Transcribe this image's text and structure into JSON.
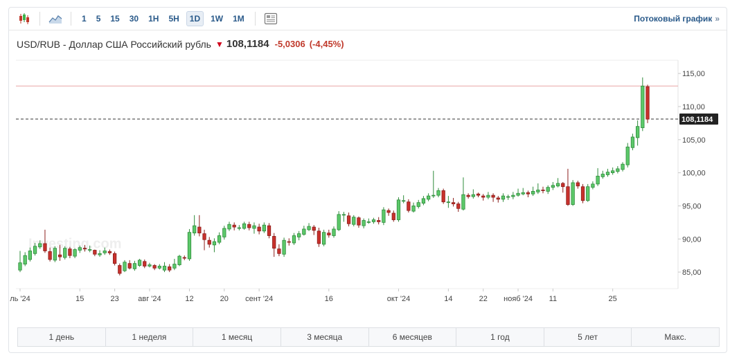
{
  "toolbar": {
    "timeframes": [
      "1",
      "5",
      "15",
      "30",
      "1H",
      "5H",
      "1D",
      "1W",
      "1M"
    ],
    "active_timeframe": "1D",
    "stream_label": "Потоковый график",
    "stream_chevron": "»"
  },
  "quote": {
    "title": "USD/RUB - Доллар США Российский рубль",
    "arrow": "🡇",
    "price": "108,1184",
    "change": "-5,0306",
    "change_pct": "(-4,45%)"
  },
  "ranges": [
    "1 день",
    "1 неделя",
    "1 месяц",
    "3 месяца",
    "6 месяцев",
    "1 год",
    "5 лет",
    "Макс."
  ],
  "colors": {
    "up": "#3cb44b",
    "down": "#c0392b",
    "up_fill": "#5cc86a",
    "down_fill": "#c8312c",
    "grid": "#ededed",
    "hline": "#e8a6a6"
  },
  "chart_data": {
    "type": "candlestick",
    "title": "",
    "ylim": [
      82.5,
      117
    ],
    "y_ticks": [
      "115,00",
      "110,00",
      "105,00",
      "100,00",
      "95,00",
      "90,00",
      "85,00"
    ],
    "y_tick_values": [
      115,
      110,
      105,
      100,
      95,
      90,
      85
    ],
    "x_ticks": [
      "ль '24",
      "15",
      "23",
      "авг '24",
      "12",
      "20",
      "сент '24",
      "16",
      "окт '24",
      "14",
      "22",
      "нояб '24",
      "11",
      "25"
    ],
    "x_tick_index": [
      0,
      12,
      19,
      26,
      34,
      41,
      48,
      62,
      76,
      86,
      93,
      100,
      107,
      119
    ],
    "last_price": 108.1184,
    "last_label": "108,1184",
    "hline": 113.1,
    "candles": [
      [
        85.3,
        86.4,
        88.2,
        85.0
      ],
      [
        86.2,
        87.5,
        88.0,
        85.9
      ],
      [
        86.9,
        88.2,
        88.7,
        86.6
      ],
      [
        87.8,
        88.9,
        89.4,
        87.5
      ],
      [
        88.8,
        89.3,
        89.8,
        88.5
      ],
      [
        89.3,
        88.2,
        91.4,
        87.9
      ],
      [
        88.1,
        86.9,
        88.7,
        86.6
      ],
      [
        86.8,
        88.6,
        88.9,
        86.5
      ],
      [
        87.6,
        87.3,
        89.1,
        86.7
      ],
      [
        87.2,
        88.6,
        88.9,
        86.9
      ],
      [
        88.5,
        87.5,
        88.8,
        87.1
      ],
      [
        87.4,
        88.4,
        88.6,
        87.1
      ],
      [
        88.3,
        88.7,
        89.0,
        87.9
      ],
      [
        88.6,
        88.5,
        89.1,
        88.1
      ],
      [
        88.4,
        88.4,
        89.0,
        88.0
      ],
      [
        88.3,
        87.7,
        88.4,
        87.4
      ],
      [
        87.6,
        87.8,
        88.3,
        87.3
      ],
      [
        87.9,
        88.2,
        88.7,
        87.6
      ],
      [
        88.1,
        87.9,
        88.4,
        87.6
      ],
      [
        87.8,
        86.3,
        88.1,
        86.0
      ],
      [
        86.0,
        84.8,
        86.3,
        84.5
      ],
      [
        85.2,
        86.5,
        86.8,
        85.0
      ],
      [
        86.3,
        85.6,
        86.8,
        85.4
      ],
      [
        85.5,
        86.3,
        86.7,
        85.2
      ],
      [
        86.0,
        86.8,
        87.0,
        85.8
      ],
      [
        86.6,
        85.9,
        86.9,
        85.6
      ],
      [
        85.9,
        86.1,
        86.4,
        85.7
      ],
      [
        86.0,
        85.6,
        86.2,
        85.3
      ],
      [
        85.6,
        85.9,
        86.2,
        85.4
      ],
      [
        85.3,
        85.9,
        86.5,
        85.0
      ],
      [
        85.8,
        85.3,
        86.2,
        85.0
      ],
      [
        85.6,
        86.2,
        87.0,
        85.3
      ],
      [
        86.1,
        87.4,
        87.6,
        85.9
      ],
      [
        87.2,
        87.1,
        87.5,
        86.8
      ],
      [
        87.0,
        91.0,
        91.5,
        86.7
      ],
      [
        90.9,
        92.0,
        93.6,
        90.5
      ],
      [
        91.8,
        90.9,
        93.6,
        90.4
      ],
      [
        90.8,
        89.9,
        91.4,
        88.3
      ],
      [
        89.8,
        89.2,
        90.3,
        88.7
      ],
      [
        89.1,
        89.6,
        90.1,
        88.0
      ],
      [
        89.5,
        90.5,
        91.0,
        89.2
      ],
      [
        90.3,
        91.6,
        92.0,
        89.9
      ],
      [
        91.5,
        92.2,
        92.6,
        91.2
      ],
      [
        92.1,
        91.8,
        92.5,
        91.3
      ],
      [
        91.7,
        91.7,
        92.1,
        91.3
      ],
      [
        91.6,
        92.3,
        92.6,
        91.4
      ],
      [
        92.2,
        91.7,
        92.6,
        91.3
      ],
      [
        91.6,
        92.0,
        92.5,
        90.8
      ],
      [
        91.8,
        91.2,
        92.3,
        90.7
      ],
      [
        91.2,
        92.1,
        92.5,
        90.9
      ],
      [
        92.0,
        90.5,
        92.4,
        90.1
      ],
      [
        90.4,
        88.6,
        90.9,
        87.3
      ],
      [
        88.5,
        87.8,
        89.2,
        87.4
      ],
      [
        87.7,
        89.8,
        90.2,
        87.3
      ],
      [
        89.6,
        89.5,
        90.1,
        89.0
      ],
      [
        89.4,
        90.5,
        90.9,
        89.1
      ],
      [
        90.3,
        90.8,
        91.2,
        89.8
      ],
      [
        90.7,
        91.5,
        92.0,
        90.5
      ],
      [
        91.4,
        91.9,
        92.4,
        91.2
      ],
      [
        91.8,
        91.3,
        92.1,
        90.6
      ],
      [
        91.2,
        89.3,
        91.7,
        88.8
      ],
      [
        89.2,
        91.0,
        91.4,
        88.9
      ],
      [
        90.9,
        90.6,
        91.4,
        90.2
      ],
      [
        90.5,
        91.5,
        91.9,
        90.2
      ],
      [
        91.4,
        93.7,
        94.2,
        91.2
      ],
      [
        93.6,
        93.7,
        94.1,
        92.6
      ],
      [
        93.5,
        92.3,
        94.0,
        91.9
      ],
      [
        92.2,
        93.3,
        93.6,
        91.9
      ],
      [
        93.2,
        92.1,
        93.4,
        91.7
      ],
      [
        92.0,
        92.8,
        93.1,
        91.6
      ],
      [
        92.6,
        92.6,
        93.1,
        92.3
      ],
      [
        92.6,
        92.9,
        93.2,
        92.3
      ],
      [
        92.8,
        92.6,
        93.3,
        92.2
      ],
      [
        92.5,
        94.4,
        94.8,
        92.1
      ],
      [
        94.3,
        94.0,
        94.6,
        93.5
      ],
      [
        93.9,
        92.9,
        94.3,
        92.6
      ],
      [
        92.9,
        95.9,
        96.3,
        92.6
      ],
      [
        95.8,
        95.8,
        96.6,
        95.4
      ],
      [
        95.6,
        94.3,
        96.0,
        94.0
      ],
      [
        94.2,
        95.0,
        95.5,
        94.0
      ],
      [
        94.9,
        95.5,
        95.9,
        94.6
      ],
      [
        95.4,
        96.1,
        96.5,
        95.1
      ],
      [
        96.0,
        96.5,
        96.9,
        95.7
      ],
      [
        96.5,
        96.6,
        100.3,
        96.2
      ],
      [
        96.6,
        97.3,
        97.7,
        96.3
      ],
      [
        97.3,
        95.6,
        97.6,
        95.3
      ],
      [
        95.6,
        95.6,
        96.5,
        94.7
      ],
      [
        95.5,
        95.3,
        96.2,
        94.9
      ],
      [
        95.3,
        94.6,
        95.6,
        94.1
      ],
      [
        94.5,
        96.7,
        99.3,
        94.3
      ],
      [
        96.6,
        96.4,
        96.9,
        96.1
      ],
      [
        96.4,
        96.7,
        97.5,
        96.1
      ],
      [
        96.8,
        96.6,
        97.0,
        96.3
      ],
      [
        96.5,
        96.3,
        96.8,
        95.8
      ],
      [
        96.3,
        96.6,
        97.1,
        96.0
      ],
      [
        96.6,
        96.3,
        96.9,
        95.6
      ],
      [
        96.2,
        96.0,
        96.5,
        95.5
      ],
      [
        96.0,
        96.5,
        96.9,
        95.6
      ],
      [
        96.4,
        96.4,
        96.7,
        95.9
      ],
      [
        96.4,
        96.6,
        97.1,
        96.0
      ],
      [
        96.6,
        96.9,
        97.6,
        96.4
      ],
      [
        96.8,
        97.0,
        97.7,
        96.6
      ],
      [
        97.0,
        96.8,
        97.3,
        96.3
      ],
      [
        96.8,
        97.2,
        97.9,
        96.5
      ],
      [
        97.1,
        97.4,
        98.4,
        96.8
      ],
      [
        97.4,
        97.3,
        97.9,
        96.9
      ],
      [
        97.2,
        97.8,
        98.1,
        96.8
      ],
      [
        97.8,
        98.1,
        98.6,
        97.4
      ],
      [
        98.0,
        98.4,
        99.2,
        97.8
      ],
      [
        98.4,
        97.9,
        98.6,
        97.0
      ],
      [
        97.9,
        95.2,
        100.6,
        95.0
      ],
      [
        95.2,
        98.5,
        98.9,
        95.0
      ],
      [
        98.5,
        98.0,
        98.8,
        97.6
      ],
      [
        97.9,
        95.8,
        98.3,
        95.4
      ],
      [
        95.8,
        97.9,
        98.3,
        95.6
      ],
      [
        97.8,
        98.3,
        98.7,
        97.5
      ],
      [
        98.3,
        99.5,
        100.7,
        98.0
      ],
      [
        99.4,
        99.8,
        100.3,
        99.1
      ],
      [
        99.7,
        100.1,
        100.6,
        99.4
      ],
      [
        100.0,
        100.3,
        100.8,
        99.7
      ],
      [
        100.2,
        100.6,
        101.0,
        99.9
      ],
      [
        100.5,
        101.3,
        101.6,
        100.2
      ],
      [
        101.2,
        103.9,
        104.5,
        100.8
      ],
      [
        103.8,
        105.4,
        105.9,
        103.4
      ],
      [
        105.3,
        107.0,
        107.9,
        104.1
      ],
      [
        106.8,
        113.1,
        114.4,
        106.3
      ],
      [
        113.0,
        108.1,
        113.3,
        107.5
      ]
    ],
    "watermark": "Investing.com"
  }
}
